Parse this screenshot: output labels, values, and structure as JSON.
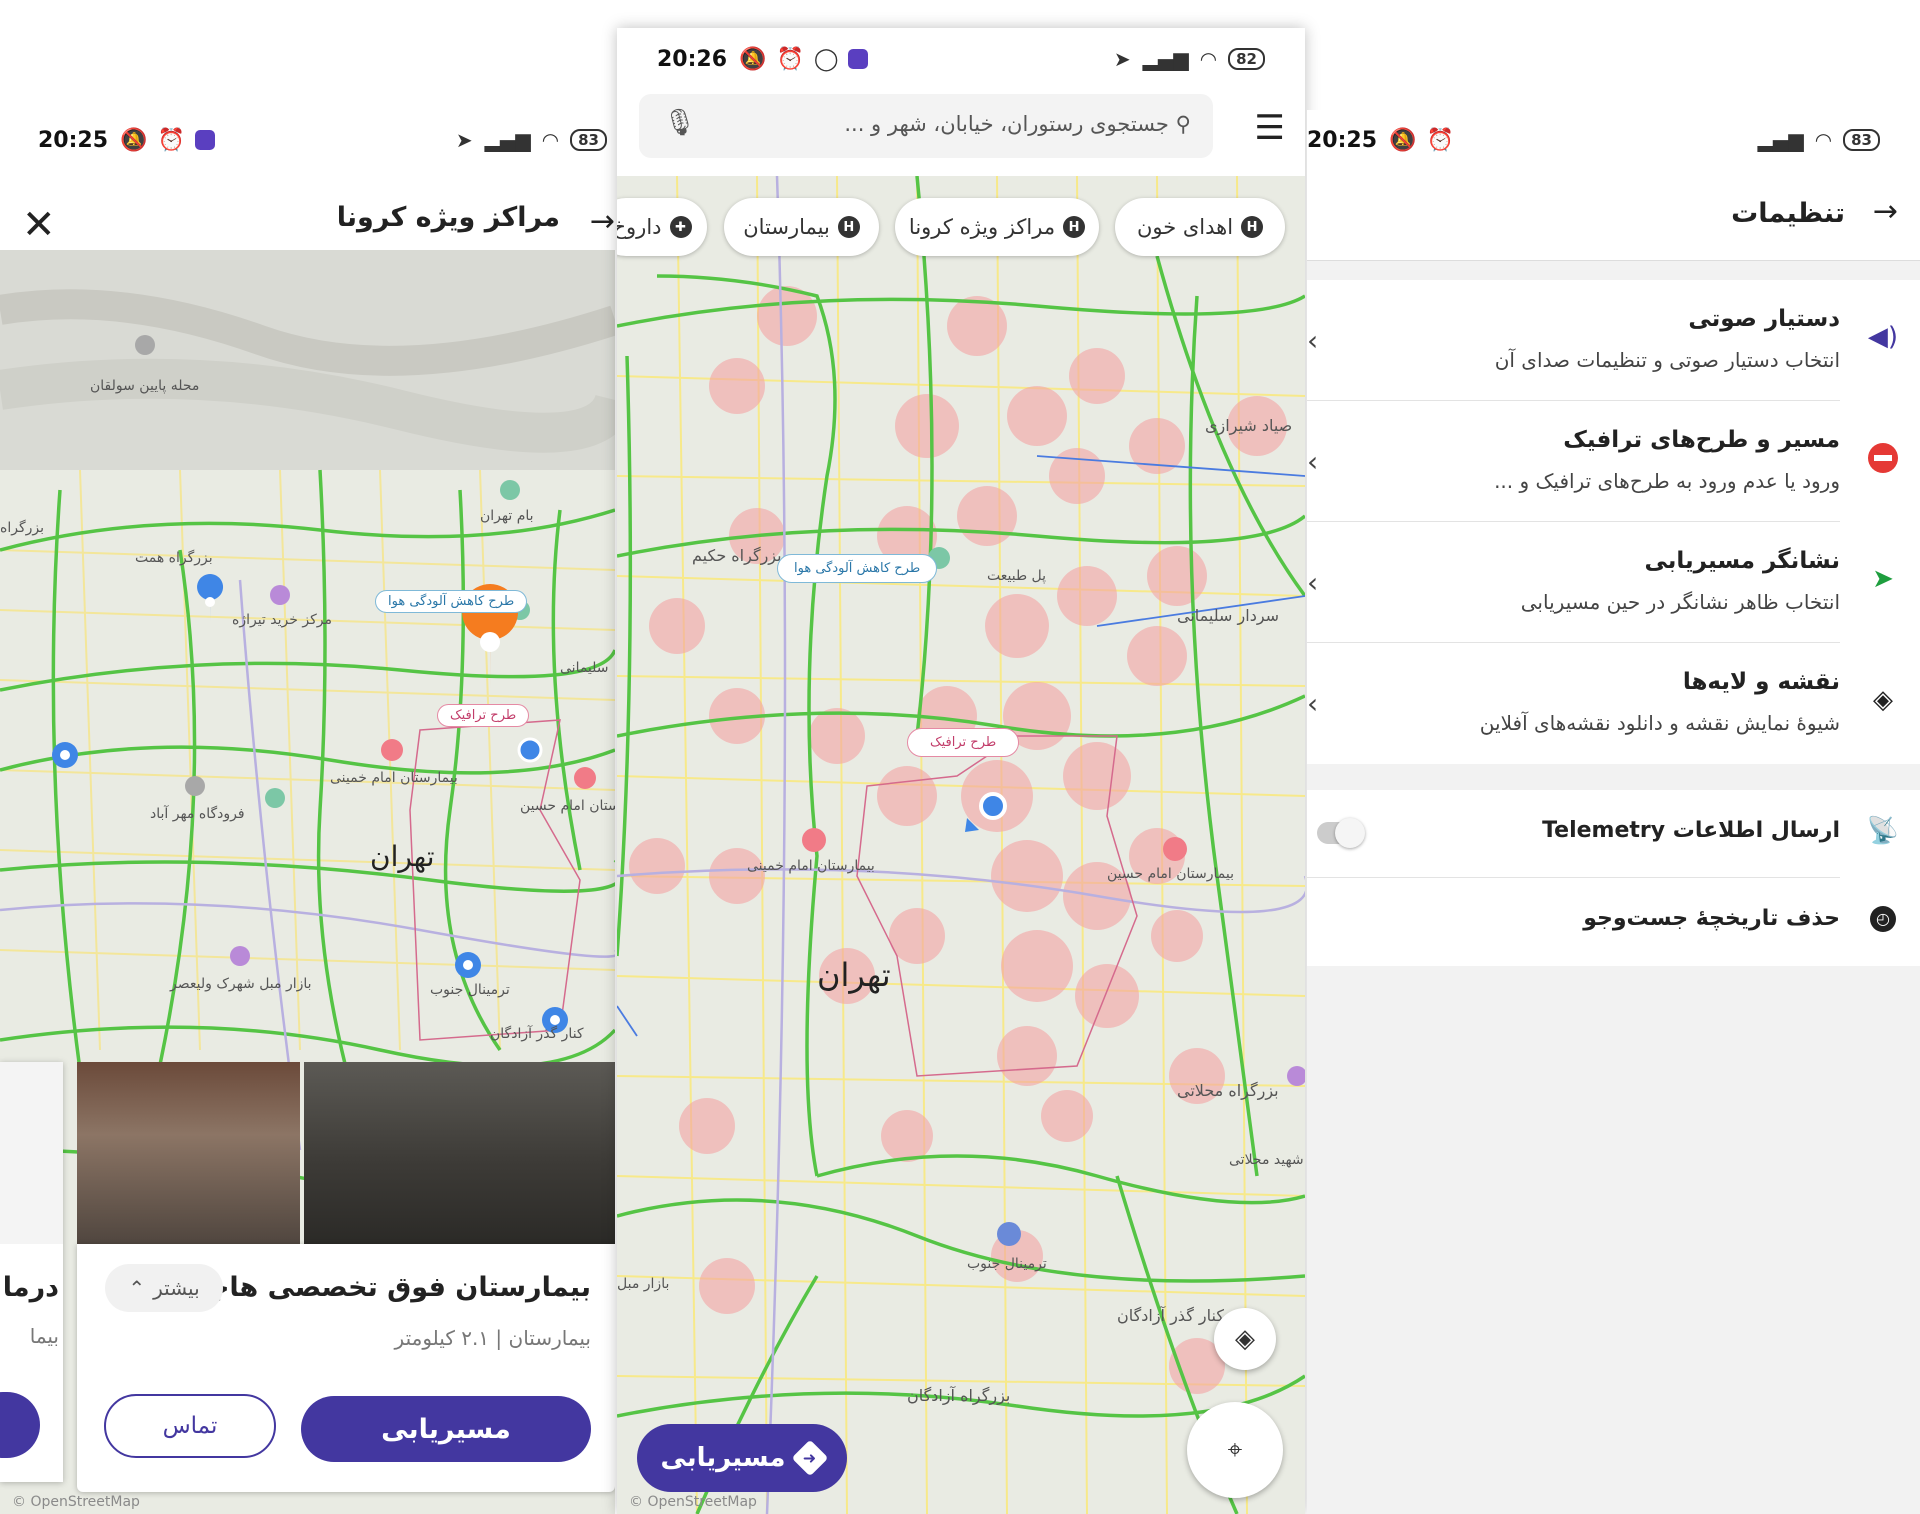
{
  "left_screen": {
    "status": {
      "time": "20:25",
      "battery": "83"
    },
    "header": {
      "title": "مراکز ویژه کرونا"
    },
    "map_labels": {
      "city": "تهران",
      "l1": "محله پایین سولقان",
      "l2": "بام تهران",
      "l3": "بزرگراه همت",
      "l4": "مرکز خرید تیراژه",
      "l5": "فرودگاه مهر آباد",
      "l6": "بیمارستان امام خمینی",
      "l7": "بیمارستان امام حسین",
      "l8": "بازار مبل شهرک ولیعصر",
      "l9": "ترمینال جنوب",
      "l10": "کنار گذر آزادگان",
      "l11": "بزرگراه",
      "l12": "سلیمانی",
      "tag_air": "طرح کاهش آلودگی هوا",
      "tag_traffic": "طرح ترافیک"
    },
    "card": {
      "name": "بیمارستان فوق تخصصی هاجر",
      "more": "بیشتر",
      "sub": "بیمارستان | ۲.۱ کیلومتر",
      "route_btn": "مسیریابی",
      "call_btn": "تماس",
      "partial_name": "درما",
      "partial_sub": "بیما"
    },
    "attribution": "© OpenStreetMap"
  },
  "middle_screen": {
    "status": {
      "time": "20:26",
      "battery": "82"
    },
    "search": {
      "placeholder": "جستجوی رستوران، خیابان، شهر و ..."
    },
    "chips": [
      "اهدای خون",
      "مراکز ویژه کرونا",
      "بیمارستان",
      "داروخ"
    ],
    "map_labels": {
      "city": "تهران",
      "l1": "بزرگراه حکیم",
      "l2": "پل طبیعت",
      "l3": "بیمارستان امام خمینی",
      "l4": "بیمارستان امام حسین",
      "l5": "ترمینال جنوب",
      "l6": "کنار گذر آزادگان",
      "l7": "بزرگراه آزادگان",
      "l8": "بزرگراه محلاتی",
      "l9": "شهید محلاتی",
      "l10": "بازار مبل",
      "l11": "سردار سلیمانی",
      "l12": "صیاد شیرازی",
      "tag_air": "طرح کاهش آلودگی هوا",
      "tag_traffic": "طرح ترافیک"
    },
    "route_fab": "مسیریابی",
    "attribution": "© OpenStreetMap"
  },
  "right_screen": {
    "status": {
      "time": "20:25",
      "battery": "83"
    },
    "header": {
      "title": "تنظیمات"
    },
    "items": [
      {
        "title": "دستیار صوتی",
        "subtitle": "انتخاب دستیار صوتی و تنظیمات صدای آن",
        "icon": "voice-assistant-icon",
        "color": "#4337a0"
      },
      {
        "title": "مسیر و طرح‌های ترافیک",
        "subtitle": "ورود یا عدم ورود به طرح‌های ترافیک و ...",
        "icon": "no-entry-icon",
        "color": "#e53935"
      },
      {
        "title": "نشانگر مسیریابی",
        "subtitle": "انتخاب ظاهر نشانگر در حین مسیریابی",
        "icon": "navigation-arrow-icon",
        "color": "#1e9e3e"
      },
      {
        "title": "نقشه و لایه‌ها",
        "subtitle": "شیوهٔ نمایش نقشه و دانلود نقشه‌های آفلاین",
        "icon": "layers-icon",
        "color": "#222222"
      }
    ],
    "telemetry": {
      "title": "ارسال اطلاعات Telemetry",
      "enabled": false
    },
    "clear_history": {
      "title": "حذف تاریخچهٔ جست‌وجو"
    }
  },
  "colors": {
    "accent": "#4337a0",
    "traffic_green": "#55c445",
    "heat_red": "#f4a4a4",
    "road_yellow": "#f7e98a"
  }
}
